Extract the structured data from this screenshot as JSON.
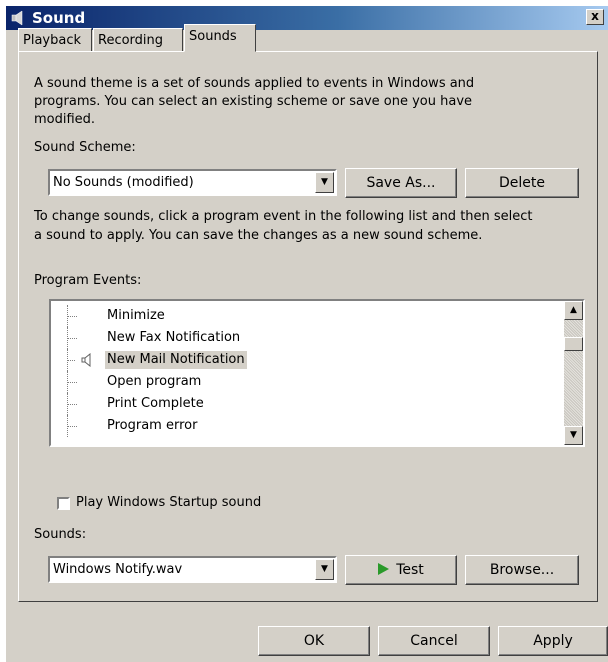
{
  "window": {
    "title": "Sound",
    "close_label": "x"
  },
  "tabs": [
    {
      "label": "Playback"
    },
    {
      "label": "Recording"
    },
    {
      "label": "Sounds"
    }
  ],
  "description": [
    "A sound theme is a set of sounds applied to events in Windows and",
    "programs.  You can select an existing scheme or save one you have",
    "modified."
  ],
  "scheme": {
    "label": "Sound Scheme:",
    "value": "No Sounds (modified)",
    "save_as": "Save As...",
    "delete": "Delete"
  },
  "instructions": [
    "To change sounds, click a program event in the following list and then select",
    "a sound to apply.  You can save the changes as a new sound scheme."
  ],
  "events": {
    "label": "Program Events:",
    "items": [
      {
        "label": "Minimize"
      },
      {
        "label": "New Fax Notification"
      },
      {
        "label": "New Mail Notification"
      },
      {
        "label": "Open program"
      },
      {
        "label": "Print Complete"
      },
      {
        "label": "Program error"
      }
    ],
    "selected_index": 2
  },
  "startup": {
    "label": "Play Windows Startup sound",
    "checked": false
  },
  "sounds": {
    "label": "Sounds:",
    "value": "Windows Notify.wav",
    "test": "Test",
    "browse": "Browse..."
  },
  "footer": {
    "ok": "OK",
    "cancel": "Cancel",
    "apply": "Apply"
  },
  "icons": {
    "window": "speaker-icon",
    "play": "play-icon",
    "event_sound": "speaker-icon"
  },
  "colors": {
    "title_start": "#0a246a",
    "title_end": "#a6caf0",
    "face": "#d4d0c8",
    "play": "#2a9a2a"
  }
}
